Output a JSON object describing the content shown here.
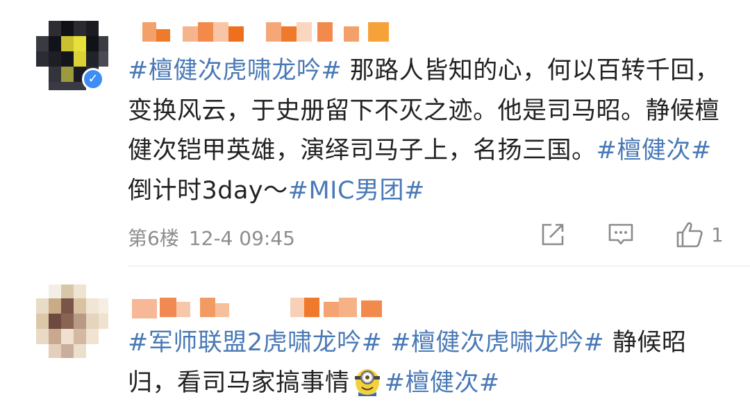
{
  "comments": [
    {
      "verified_mark": "✓",
      "body_parts": [
        {
          "text": "#檀健次虎啸龙吟#",
          "tag": true
        },
        {
          "text": " 那路人皆知的心，何以百转千回，变换风云，于史册留下不灭之迹。他是司马昭。静候檀健次铠甲英雄，演绎司马子上，名扬三国。",
          "tag": false
        },
        {
          "text": "#檀健次#",
          "tag": true
        },
        {
          "text": " 倒计时3day～",
          "tag": false
        },
        {
          "text": "#MIC男团#",
          "tag": true
        }
      ],
      "floor": "第6楼",
      "time": "12-4 09:45",
      "actions": {
        "repost_icon": "share-icon",
        "comment_icon": "comment-icon",
        "like_icon": "thumbs-up-icon",
        "like_count": "1"
      }
    },
    {
      "body_parts": [
        {
          "text": "#军师联盟2虎啸龙吟#",
          "tag": true
        },
        {
          "text": " ",
          "tag": false
        },
        {
          "text": "#檀健次虎啸龙吟#",
          "tag": true
        },
        {
          "text": " 静候昭归，看司马家搞事情",
          "tag": false
        },
        {
          "text": "#檀健次#",
          "tag": true
        }
      ],
      "emoji": "minion-emoji"
    }
  ],
  "colors": {
    "tag": "#4979b6",
    "text": "#222222",
    "meta": "#8d8d8d",
    "verified": "#3d8df4"
  }
}
